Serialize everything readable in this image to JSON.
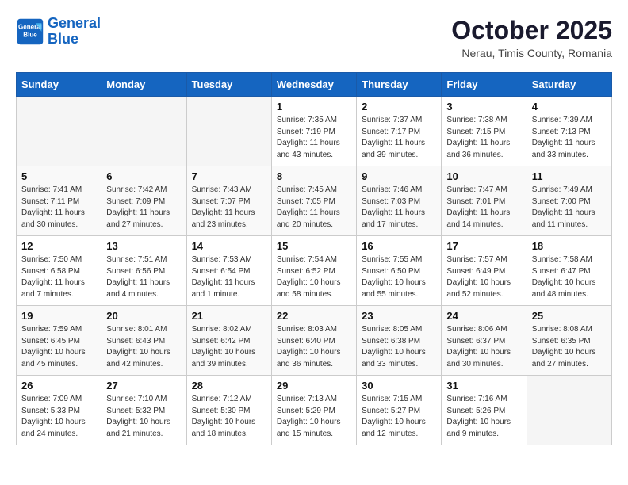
{
  "header": {
    "logo_line1": "General",
    "logo_line2": "Blue",
    "month": "October 2025",
    "location": "Nerau, Timis County, Romania"
  },
  "days_of_week": [
    "Sunday",
    "Monday",
    "Tuesday",
    "Wednesday",
    "Thursday",
    "Friday",
    "Saturday"
  ],
  "weeks": [
    [
      {
        "day": "",
        "info": ""
      },
      {
        "day": "",
        "info": ""
      },
      {
        "day": "",
        "info": ""
      },
      {
        "day": "1",
        "info": "Sunrise: 7:35 AM\nSunset: 7:19 PM\nDaylight: 11 hours\nand 43 minutes."
      },
      {
        "day": "2",
        "info": "Sunrise: 7:37 AM\nSunset: 7:17 PM\nDaylight: 11 hours\nand 39 minutes."
      },
      {
        "day": "3",
        "info": "Sunrise: 7:38 AM\nSunset: 7:15 PM\nDaylight: 11 hours\nand 36 minutes."
      },
      {
        "day": "4",
        "info": "Sunrise: 7:39 AM\nSunset: 7:13 PM\nDaylight: 11 hours\nand 33 minutes."
      }
    ],
    [
      {
        "day": "5",
        "info": "Sunrise: 7:41 AM\nSunset: 7:11 PM\nDaylight: 11 hours\nand 30 minutes."
      },
      {
        "day": "6",
        "info": "Sunrise: 7:42 AM\nSunset: 7:09 PM\nDaylight: 11 hours\nand 27 minutes."
      },
      {
        "day": "7",
        "info": "Sunrise: 7:43 AM\nSunset: 7:07 PM\nDaylight: 11 hours\nand 23 minutes."
      },
      {
        "day": "8",
        "info": "Sunrise: 7:45 AM\nSunset: 7:05 PM\nDaylight: 11 hours\nand 20 minutes."
      },
      {
        "day": "9",
        "info": "Sunrise: 7:46 AM\nSunset: 7:03 PM\nDaylight: 11 hours\nand 17 minutes."
      },
      {
        "day": "10",
        "info": "Sunrise: 7:47 AM\nSunset: 7:01 PM\nDaylight: 11 hours\nand 14 minutes."
      },
      {
        "day": "11",
        "info": "Sunrise: 7:49 AM\nSunset: 7:00 PM\nDaylight: 11 hours\nand 11 minutes."
      }
    ],
    [
      {
        "day": "12",
        "info": "Sunrise: 7:50 AM\nSunset: 6:58 PM\nDaylight: 11 hours\nand 7 minutes."
      },
      {
        "day": "13",
        "info": "Sunrise: 7:51 AM\nSunset: 6:56 PM\nDaylight: 11 hours\nand 4 minutes."
      },
      {
        "day": "14",
        "info": "Sunrise: 7:53 AM\nSunset: 6:54 PM\nDaylight: 11 hours\nand 1 minute."
      },
      {
        "day": "15",
        "info": "Sunrise: 7:54 AM\nSunset: 6:52 PM\nDaylight: 10 hours\nand 58 minutes."
      },
      {
        "day": "16",
        "info": "Sunrise: 7:55 AM\nSunset: 6:50 PM\nDaylight: 10 hours\nand 55 minutes."
      },
      {
        "day": "17",
        "info": "Sunrise: 7:57 AM\nSunset: 6:49 PM\nDaylight: 10 hours\nand 52 minutes."
      },
      {
        "day": "18",
        "info": "Sunrise: 7:58 AM\nSunset: 6:47 PM\nDaylight: 10 hours\nand 48 minutes."
      }
    ],
    [
      {
        "day": "19",
        "info": "Sunrise: 7:59 AM\nSunset: 6:45 PM\nDaylight: 10 hours\nand 45 minutes."
      },
      {
        "day": "20",
        "info": "Sunrise: 8:01 AM\nSunset: 6:43 PM\nDaylight: 10 hours\nand 42 minutes."
      },
      {
        "day": "21",
        "info": "Sunrise: 8:02 AM\nSunset: 6:42 PM\nDaylight: 10 hours\nand 39 minutes."
      },
      {
        "day": "22",
        "info": "Sunrise: 8:03 AM\nSunset: 6:40 PM\nDaylight: 10 hours\nand 36 minutes."
      },
      {
        "day": "23",
        "info": "Sunrise: 8:05 AM\nSunset: 6:38 PM\nDaylight: 10 hours\nand 33 minutes."
      },
      {
        "day": "24",
        "info": "Sunrise: 8:06 AM\nSunset: 6:37 PM\nDaylight: 10 hours\nand 30 minutes."
      },
      {
        "day": "25",
        "info": "Sunrise: 8:08 AM\nSunset: 6:35 PM\nDaylight: 10 hours\nand 27 minutes."
      }
    ],
    [
      {
        "day": "26",
        "info": "Sunrise: 7:09 AM\nSunset: 5:33 PM\nDaylight: 10 hours\nand 24 minutes."
      },
      {
        "day": "27",
        "info": "Sunrise: 7:10 AM\nSunset: 5:32 PM\nDaylight: 10 hours\nand 21 minutes."
      },
      {
        "day": "28",
        "info": "Sunrise: 7:12 AM\nSunset: 5:30 PM\nDaylight: 10 hours\nand 18 minutes."
      },
      {
        "day": "29",
        "info": "Sunrise: 7:13 AM\nSunset: 5:29 PM\nDaylight: 10 hours\nand 15 minutes."
      },
      {
        "day": "30",
        "info": "Sunrise: 7:15 AM\nSunset: 5:27 PM\nDaylight: 10 hours\nand 12 minutes."
      },
      {
        "day": "31",
        "info": "Sunrise: 7:16 AM\nSunset: 5:26 PM\nDaylight: 10 hours\nand 9 minutes."
      },
      {
        "day": "",
        "info": ""
      }
    ]
  ]
}
